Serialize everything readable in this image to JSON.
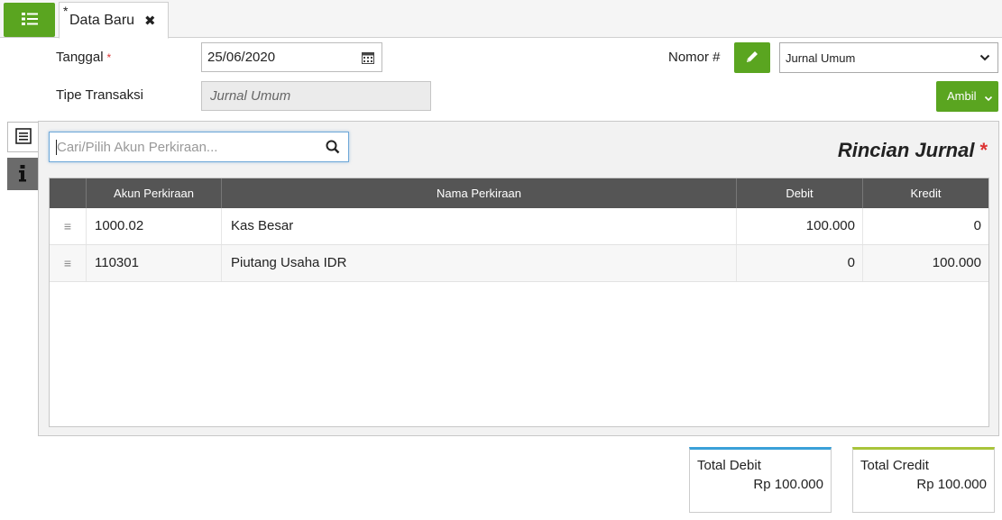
{
  "tab": {
    "modified_marker": "*",
    "title": "Data Baru",
    "close": "✖"
  },
  "form": {
    "tanggal_label": "Tanggal",
    "required_marker": "*",
    "tanggal_value": "25/06/2020",
    "tipe_label": "Tipe Transaksi",
    "tipe_value": "Jurnal Umum",
    "nomor_label": "Nomor #",
    "nomor_select_value": "Jurnal Umum",
    "ambil_label": "Ambil"
  },
  "panel": {
    "search_placeholder": "Cari/Pilih Akun Perkiraan...",
    "title": "Rincian Jurnal",
    "title_required": "*"
  },
  "table": {
    "columns": [
      "Akun Perkiraan",
      "Nama Perkiraan",
      "Debit",
      "Kredit"
    ],
    "rows": [
      {
        "akun": "1000.02",
        "nama": "Kas Besar",
        "debit": "100.000",
        "kredit": "0"
      },
      {
        "akun": "110301",
        "nama": "Piutang Usaha IDR",
        "debit": "0",
        "kredit": "100.000"
      }
    ]
  },
  "totals": {
    "debit_label": "Total Debit",
    "debit_value": "Rp 100.000",
    "credit_label": "Total Credit",
    "credit_value": "Rp 100.000"
  },
  "colors": {
    "accent": "#5aa520",
    "debit_bar": "#3aa0d8",
    "credit_bar": "#a8c43a"
  },
  "icons": [
    "list-menu-icon",
    "close-icon",
    "calendar-icon",
    "pencil-icon",
    "chevron-down-icon",
    "caret-down-icon",
    "list-view-icon",
    "info-icon",
    "search-icon",
    "drag-handle-icon"
  ]
}
